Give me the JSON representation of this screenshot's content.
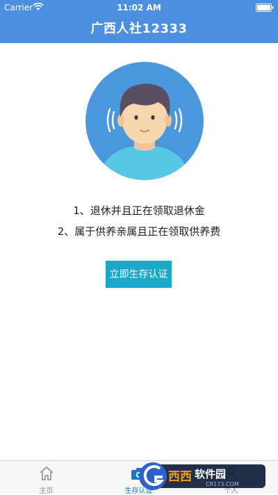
{
  "status_bar": {
    "carrier": "Carrier",
    "time": "11:02 AM"
  },
  "nav": {
    "title": "广西人社12333"
  },
  "requirements": [
    "1、退休并且正在领取退休金",
    "2、属于供养亲属且正在领取供养费"
  ],
  "actions": {
    "verify_label": "立即生存认证"
  },
  "tabs": [
    {
      "label": "主页",
      "icon": "home-icon",
      "active": false
    },
    {
      "label": "生存认证",
      "icon": "camera-icon",
      "active": true
    },
    {
      "label": "个人",
      "icon": "person-icon",
      "active": false
    }
  ],
  "watermark": {
    "brand": "西西软件园",
    "url": "CR173.COM"
  },
  "colors": {
    "header": "#4a8fe0",
    "avatar_bg": "#4a98db",
    "button": "#1ca9c9",
    "active_tab": "#1a78c2"
  }
}
